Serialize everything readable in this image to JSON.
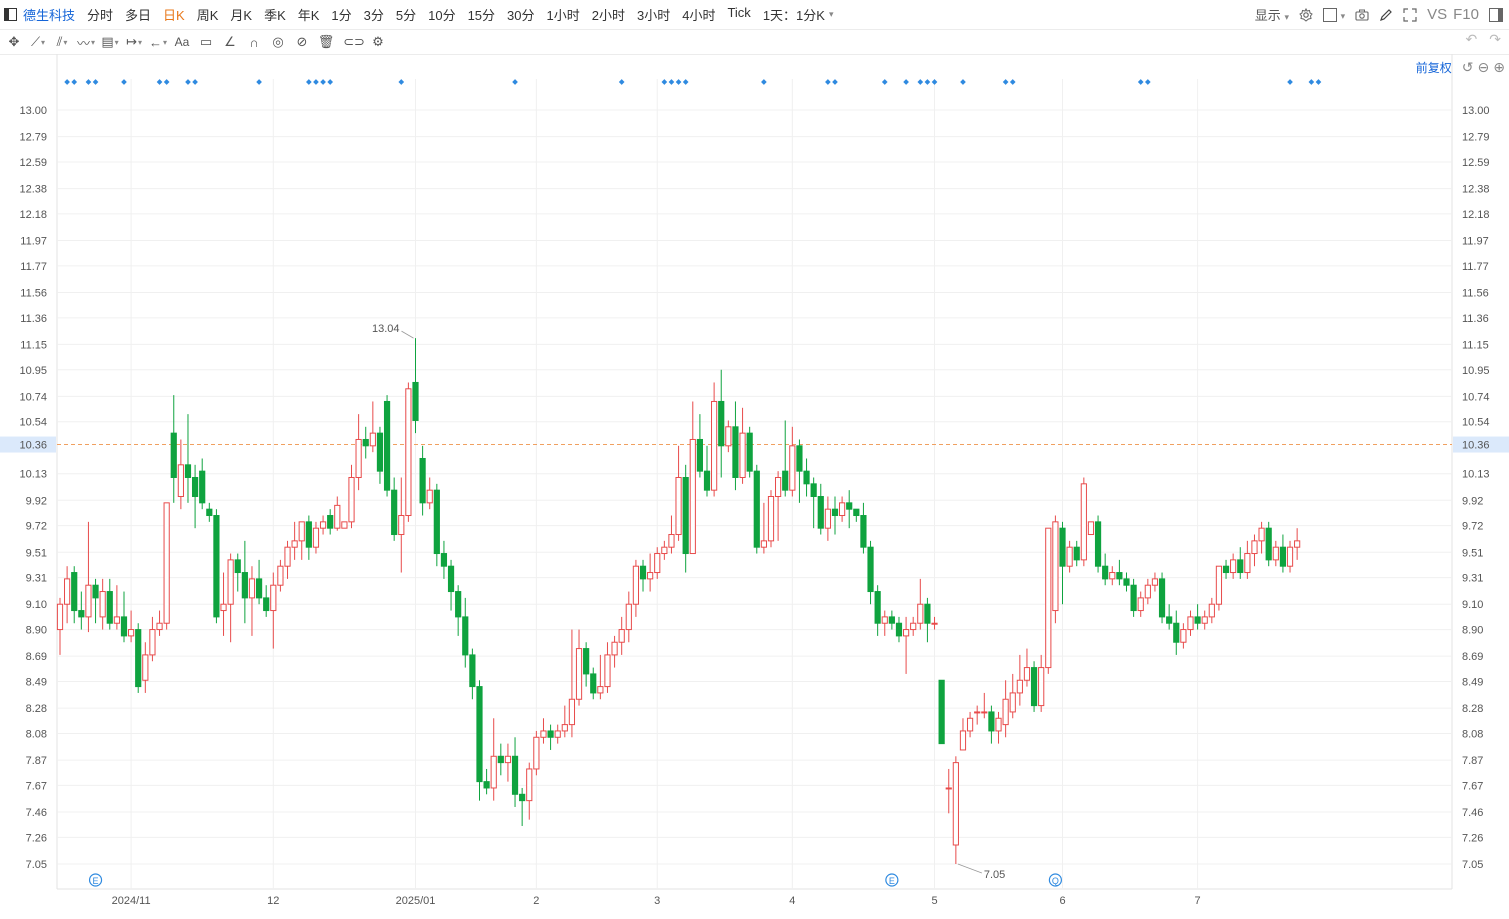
{
  "toolbar": {
    "stock_name": "德生科技",
    "timeframes": [
      "分时",
      "多日",
      "日K",
      "周K",
      "月K",
      "季K",
      "年K",
      "1分",
      "3分",
      "5分",
      "10分",
      "15分",
      "30分",
      "1小时",
      "2小时",
      "3小时",
      "4小时",
      "Tick",
      "1天：1分K"
    ],
    "active_timeframe": "日K",
    "display_label": "显示",
    "vs_label": "VS",
    "f10_label": "F10"
  },
  "adjustment": {
    "label": "前复权"
  },
  "colors": {
    "up": "#e84b4b",
    "down": "#0fa33f",
    "accent": "#1565d8",
    "price_line": "#f0a060",
    "event": "#2f8ae0"
  },
  "chart_data": {
    "type": "candlestick",
    "ylim": [
      7.05,
      13.04
    ],
    "y_ticks": [
      "13.00",
      "12.79",
      "12.59",
      "12.38",
      "12.18",
      "11.97",
      "11.77",
      "11.56",
      "11.36",
      "11.15",
      "10.95",
      "10.74",
      "10.54",
      "10.36",
      "10.13",
      "9.92",
      "9.72",
      "9.51",
      "9.31",
      "9.10",
      "8.90",
      "8.69",
      "8.49",
      "8.28",
      "8.08",
      "7.87",
      "7.67",
      "7.46",
      "7.26",
      "7.05"
    ],
    "x_ticks": [
      {
        "label": "2024/11",
        "index": 10
      },
      {
        "label": "12",
        "index": 30
      },
      {
        "label": "2025/01",
        "index": 50
      },
      {
        "label": "2",
        "index": 67
      },
      {
        "label": "3",
        "index": 84
      },
      {
        "label": "4",
        "index": 103
      },
      {
        "label": "5",
        "index": 123
      },
      {
        "label": "6",
        "index": 141
      },
      {
        "label": "7",
        "index": 160
      }
    ],
    "current_price": "10.36",
    "max_label": "13.04",
    "min_label": "7.05",
    "events": [
      {
        "label": "E",
        "index": 5
      },
      {
        "label": "E",
        "index": 117
      },
      {
        "label": "Q",
        "index": 140
      }
    ],
    "dot_indices": [
      1,
      2,
      4,
      5,
      9,
      14,
      15,
      18,
      19,
      28,
      35,
      36,
      37,
      38,
      48,
      64,
      79,
      85,
      86,
      87,
      88,
      99,
      108,
      109,
      116,
      119,
      121,
      122,
      123,
      127,
      133,
      134,
      152,
      153,
      173,
      176,
      177
    ],
    "candles": [
      [
        8.9,
        9.1,
        8.7,
        9.15
      ],
      [
        9.1,
        9.3,
        8.95,
        9.4
      ],
      [
        9.35,
        9.05,
        8.95,
        9.4
      ],
      [
        9.05,
        9.0,
        8.9,
        9.2
      ],
      [
        9.0,
        9.25,
        8.88,
        9.75
      ],
      [
        9.25,
        9.15,
        8.95,
        9.3
      ],
      [
        9.0,
        9.2,
        8.9,
        9.3
      ],
      [
        9.2,
        8.95,
        8.9,
        9.3
      ],
      [
        8.95,
        9.0,
        8.9,
        9.25
      ],
      [
        9.0,
        8.85,
        8.8,
        9.2
      ],
      [
        8.85,
        8.9,
        8.8,
        9.05
      ],
      [
        8.9,
        8.45,
        8.4,
        8.95
      ],
      [
        8.5,
        8.7,
        8.4,
        8.8
      ],
      [
        8.7,
        8.9,
        8.65,
        9.0
      ],
      [
        8.9,
        8.95,
        8.85,
        9.05
      ],
      [
        8.95,
        9.9,
        8.9,
        9.9
      ],
      [
        10.45,
        10.1,
        9.9,
        10.75
      ],
      [
        9.95,
        10.2,
        9.85,
        10.4
      ],
      [
        10.2,
        10.1,
        9.9,
        10.6
      ],
      [
        10.1,
        9.95,
        9.7,
        10.2
      ],
      [
        10.15,
        9.9,
        9.85,
        10.25
      ],
      [
        9.85,
        9.8,
        9.75,
        9.9
      ],
      [
        9.8,
        9.0,
        8.95,
        9.85
      ],
      [
        9.05,
        9.1,
        8.85,
        9.35
      ],
      [
        9.1,
        9.45,
        8.8,
        9.5
      ],
      [
        9.45,
        9.35,
        9.2,
        9.5
      ],
      [
        9.35,
        9.15,
        8.95,
        9.6
      ],
      [
        9.15,
        9.3,
        8.85,
        9.4
      ],
      [
        9.3,
        9.15,
        9.1,
        9.45
      ],
      [
        9.15,
        9.05,
        9.0,
        9.25
      ],
      [
        9.05,
        9.25,
        8.75,
        9.35
      ],
      [
        9.25,
        9.4,
        9.2,
        9.45
      ],
      [
        9.4,
        9.55,
        9.3,
        9.6
      ],
      [
        9.55,
        9.6,
        9.45,
        9.75
      ],
      [
        9.6,
        9.75,
        9.45,
        9.75
      ],
      [
        9.75,
        9.55,
        9.45,
        9.8
      ],
      [
        9.55,
        9.7,
        9.5,
        9.75
      ],
      [
        9.7,
        9.75,
        9.65,
        9.8
      ],
      [
        9.8,
        9.7,
        9.65,
        9.85
      ],
      [
        9.7,
        9.88,
        9.68,
        9.95
      ],
      [
        9.7,
        9.75,
        9.7,
        9.75
      ],
      [
        9.75,
        10.1,
        9.7,
        10.2
      ],
      [
        10.1,
        10.4,
        10.0,
        10.6
      ],
      [
        10.4,
        10.35,
        10.25,
        10.5
      ],
      [
        10.35,
        10.45,
        10.3,
        10.7
      ],
      [
        10.45,
        10.15,
        10.05,
        10.5
      ],
      [
        10.7,
        10.0,
        9.95,
        10.75
      ],
      [
        10.0,
        9.65,
        9.6,
        10.1
      ],
      [
        9.65,
        9.8,
        9.35,
        10.1
      ],
      [
        9.8,
        10.8,
        9.75,
        10.85
      ],
      [
        10.85,
        10.55,
        10.45,
        11.2
      ],
      [
        10.25,
        9.9,
        9.8,
        10.35
      ],
      [
        9.9,
        10.0,
        9.85,
        10.1
      ],
      [
        10.0,
        9.5,
        9.4,
        10.05
      ],
      [
        9.5,
        9.4,
        9.3,
        9.6
      ],
      [
        9.4,
        9.2,
        9.05,
        9.45
      ],
      [
        9.2,
        9.0,
        8.85,
        9.25
      ],
      [
        9.0,
        8.7,
        8.6,
        9.15
      ],
      [
        8.7,
        8.45,
        8.35,
        8.75
      ],
      [
        8.45,
        7.7,
        7.55,
        8.5
      ],
      [
        7.7,
        7.65,
        7.6,
        7.8
      ],
      [
        7.65,
        7.9,
        7.55,
        8.2
      ],
      [
        7.9,
        7.85,
        7.75,
        8.0
      ],
      [
        7.85,
        7.9,
        7.7,
        8.0
      ],
      [
        7.9,
        7.6,
        7.5,
        8.05
      ],
      [
        7.6,
        7.55,
        7.35,
        7.65
      ],
      [
        7.55,
        7.8,
        7.4,
        7.85
      ],
      [
        7.8,
        8.05,
        7.75,
        8.1
      ],
      [
        8.05,
        8.1,
        8.0,
        8.2
      ],
      [
        8.1,
        8.05,
        7.95,
        8.15
      ],
      [
        8.05,
        8.1,
        8.0,
        8.15
      ],
      [
        8.1,
        8.15,
        8.05,
        8.3
      ],
      [
        8.15,
        8.35,
        8.05,
        8.9
      ],
      [
        8.35,
        8.75,
        8.3,
        8.9
      ],
      [
        8.75,
        8.55,
        8.45,
        8.8
      ],
      [
        8.55,
        8.4,
        8.35,
        8.6
      ],
      [
        8.4,
        8.45,
        8.35,
        8.7
      ],
      [
        8.45,
        8.7,
        8.4,
        8.8
      ],
      [
        8.7,
        8.8,
        8.6,
        8.85
      ],
      [
        8.8,
        8.9,
        8.7,
        9.0
      ],
      [
        8.9,
        9.1,
        8.8,
        9.2
      ],
      [
        9.1,
        9.4,
        9.0,
        9.45
      ],
      [
        9.4,
        9.3,
        9.2,
        9.45
      ],
      [
        9.3,
        9.35,
        9.2,
        9.5
      ],
      [
        9.35,
        9.5,
        9.3,
        9.55
      ],
      [
        9.5,
        9.55,
        9.45,
        9.6
      ],
      [
        9.55,
        9.65,
        9.5,
        9.8
      ],
      [
        9.65,
        10.1,
        9.6,
        10.35
      ],
      [
        10.1,
        9.5,
        9.35,
        10.2
      ],
      [
        9.5,
        10.4,
        9.5,
        10.7
      ],
      [
        10.4,
        10.15,
        10.1,
        10.6
      ],
      [
        10.15,
        10.0,
        9.95,
        10.35
      ],
      [
        10.0,
        10.7,
        9.95,
        10.85
      ],
      [
        10.7,
        10.35,
        10.1,
        10.95
      ],
      [
        10.35,
        10.5,
        10.3,
        10.55
      ],
      [
        10.5,
        10.1,
        10.0,
        10.7
      ],
      [
        10.1,
        10.45,
        10.05,
        10.65
      ],
      [
        10.45,
        10.15,
        10.1,
        10.5
      ],
      [
        10.15,
        9.55,
        9.5,
        10.2
      ],
      [
        9.55,
        9.6,
        9.5,
        9.9
      ],
      [
        9.6,
        9.95,
        9.55,
        10.0
      ],
      [
        9.95,
        10.1,
        9.6,
        10.15
      ],
      [
        10.15,
        10.0,
        9.95,
        10.55
      ],
      [
        10.0,
        10.35,
        9.95,
        10.5
      ],
      [
        10.35,
        10.15,
        9.9,
        10.4
      ],
      [
        10.15,
        10.05,
        9.95,
        10.25
      ],
      [
        10.05,
        9.95,
        9.7,
        10.1
      ],
      [
        9.95,
        9.7,
        9.65,
        10.05
      ],
      [
        9.7,
        9.85,
        9.6,
        9.95
      ],
      [
        9.85,
        9.8,
        9.65,
        9.95
      ],
      [
        9.8,
        9.9,
        9.75,
        9.95
      ],
      [
        9.9,
        9.85,
        9.7,
        10.0
      ],
      [
        9.85,
        9.8,
        9.75,
        9.85
      ],
      [
        9.8,
        9.55,
        9.5,
        9.9
      ],
      [
        9.55,
        9.2,
        9.1,
        9.6
      ],
      [
        9.2,
        8.95,
        8.85,
        9.25
      ],
      [
        8.95,
        9.0,
        8.85,
        9.05
      ],
      [
        9.0,
        8.95,
        8.9,
        9.05
      ],
      [
        8.95,
        8.85,
        8.8,
        9.0
      ],
      [
        8.85,
        8.9,
        8.55,
        9.0
      ],
      [
        8.9,
        8.95,
        8.85,
        9.0
      ],
      [
        8.95,
        9.1,
        8.9,
        9.3
      ],
      [
        9.1,
        8.95,
        8.8,
        9.15
      ],
      [
        8.95,
        8.95,
        8.9,
        9.0
      ],
      [
        8.5,
        8.0,
        8.0,
        8.5
      ],
      [
        7.65,
        7.65,
        7.45,
        7.8
      ],
      [
        7.2,
        7.85,
        7.05,
        7.9
      ],
      [
        7.95,
        8.1,
        7.95,
        8.2
      ],
      [
        8.1,
        8.2,
        8.05,
        8.25
      ],
      [
        8.25,
        8.25,
        8.15,
        8.3
      ],
      [
        8.25,
        8.25,
        8.2,
        8.4
      ],
      [
        8.25,
        8.1,
        8.0,
        8.3
      ],
      [
        8.1,
        8.2,
        8.0,
        8.25
      ],
      [
        8.15,
        8.35,
        8.05,
        8.5
      ],
      [
        8.25,
        8.4,
        8.2,
        8.55
      ],
      [
        8.4,
        8.5,
        8.3,
        8.7
      ],
      [
        8.5,
        8.6,
        8.45,
        8.75
      ],
      [
        8.6,
        8.3,
        8.25,
        8.65
      ],
      [
        8.3,
        8.6,
        8.25,
        8.7
      ],
      [
        8.6,
        9.7,
        8.55,
        9.7
      ],
      [
        9.05,
        9.75,
        8.95,
        9.8
      ],
      [
        9.7,
        9.4,
        9.1,
        9.75
      ],
      [
        9.4,
        9.55,
        9.35,
        9.6
      ],
      [
        9.55,
        9.45,
        9.4,
        9.6
      ],
      [
        9.45,
        10.05,
        9.4,
        10.1
      ],
      [
        9.65,
        9.75,
        9.65,
        9.75
      ],
      [
        9.75,
        9.4,
        9.35,
        9.8
      ],
      [
        9.4,
        9.3,
        9.25,
        9.5
      ],
      [
        9.3,
        9.35,
        9.25,
        9.4
      ],
      [
        9.35,
        9.3,
        9.25,
        9.45
      ],
      [
        9.3,
        9.25,
        9.2,
        9.35
      ],
      [
        9.25,
        9.05,
        9.0,
        9.3
      ],
      [
        9.05,
        9.15,
        9.0,
        9.2
      ],
      [
        9.15,
        9.25,
        9.1,
        9.3
      ],
      [
        9.25,
        9.3,
        9.2,
        9.35
      ],
      [
        9.3,
        9.0,
        8.95,
        9.35
      ],
      [
        9.0,
        8.95,
        8.9,
        9.1
      ],
      [
        8.95,
        8.8,
        8.7,
        9.05
      ],
      [
        8.8,
        8.9,
        8.75,
        8.95
      ],
      [
        8.9,
        9.0,
        8.85,
        9.05
      ],
      [
        9.0,
        8.95,
        8.9,
        9.1
      ],
      [
        8.95,
        9.0,
        8.9,
        9.05
      ],
      [
        9.0,
        9.1,
        8.95,
        9.15
      ],
      [
        9.1,
        9.4,
        9.05,
        9.4
      ],
      [
        9.4,
        9.35,
        9.3,
        9.45
      ],
      [
        9.35,
        9.45,
        9.3,
        9.5
      ],
      [
        9.45,
        9.35,
        9.3,
        9.55
      ],
      [
        9.35,
        9.5,
        9.3,
        9.6
      ],
      [
        9.5,
        9.6,
        9.4,
        9.65
      ],
      [
        9.6,
        9.7,
        9.5,
        9.75
      ],
      [
        9.7,
        9.45,
        9.4,
        9.75
      ],
      [
        9.45,
        9.55,
        9.4,
        9.6
      ],
      [
        9.55,
        9.4,
        9.35,
        9.65
      ],
      [
        9.4,
        9.55,
        9.35,
        9.6
      ],
      [
        9.55,
        9.6,
        9.45,
        9.7
      ]
    ]
  }
}
